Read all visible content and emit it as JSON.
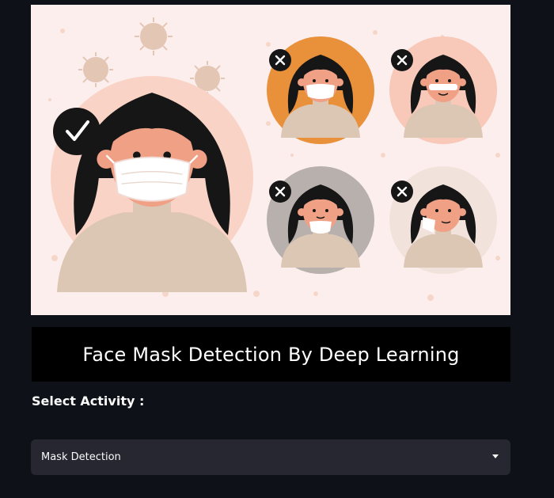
{
  "header": {
    "title": "Face Mask Detection By Deep Learning"
  },
  "hero": {
    "icons": [
      "virus-icon",
      "checkmark-icon",
      "cross-icon"
    ],
    "colors": {
      "background": "#fdeeee",
      "orange": "#e8903a",
      "peach": "#f8c8b8",
      "gray": "#b8b0ad",
      "pale": "#f2e2dc",
      "hair": "#161616",
      "skin": "#f0a085",
      "sweater": "#dcc6b4",
      "mask": "#ffffff"
    }
  },
  "activity": {
    "label": "Select Activity :",
    "selected": "Mask Detection"
  },
  "theme": {
    "page_background": "#0e1117",
    "banner_background": "#000000",
    "select_background": "#262730",
    "text": "#fafafa"
  }
}
